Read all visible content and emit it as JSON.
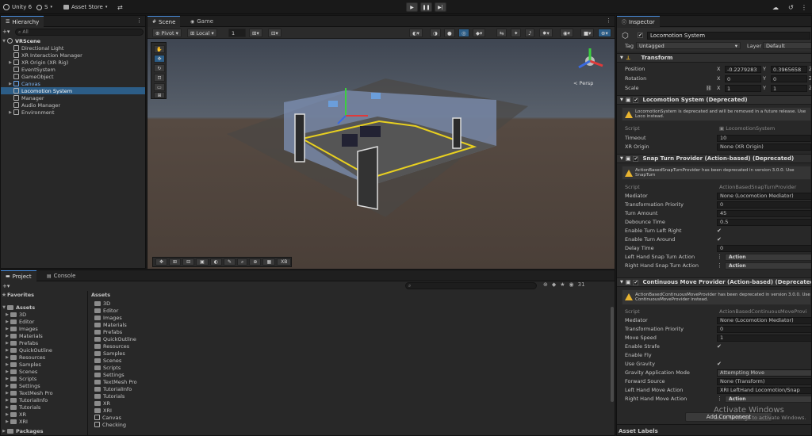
{
  "topbar": {
    "unity_label": "Unity 6",
    "account_label": "S",
    "asset_store_label": "Asset Store"
  },
  "hierarchy": {
    "tab": "Hierarchy",
    "search_placeholder": "All",
    "scene": "VRScene",
    "items": [
      {
        "label": "Directional Light",
        "indent": 1,
        "expand": false
      },
      {
        "label": "XR Interaction Manager",
        "indent": 1,
        "expand": false
      },
      {
        "label": "XR Origin (XR Rig)",
        "indent": 1,
        "expand": true
      },
      {
        "label": "EventSystem",
        "indent": 1,
        "expand": false
      },
      {
        "label": "GameObject",
        "indent": 1,
        "expand": false
      },
      {
        "label": "Canvas",
        "indent": 1,
        "expand": true,
        "blue": true
      },
      {
        "label": "Locomotion System",
        "indent": 1,
        "expand": false,
        "selected": true
      },
      {
        "label": "Manager",
        "indent": 1,
        "expand": false
      },
      {
        "label": "Audio Manager",
        "indent": 1,
        "expand": false
      },
      {
        "label": "Environment",
        "indent": 1,
        "expand": true
      }
    ]
  },
  "scene": {
    "tabs": [
      "Scene",
      "Game"
    ],
    "pivot": "Pivot",
    "local": "Local",
    "grid_value": "1",
    "persp": "< Persp",
    "bottom_tool_label": "XB"
  },
  "project": {
    "tabs": [
      "Project",
      "Console"
    ],
    "favorites": "Favorites",
    "assets_root": "Assets",
    "tree": [
      "3D",
      "Editor",
      "Images",
      "Materials",
      "Prefabs",
      "QuickOutline",
      "Resources",
      "Samples",
      "Scenes",
      "Scripts",
      "Settings",
      "TextMesh Pro",
      "TutorialInfo",
      "Tutorials",
      "XR",
      "XRI"
    ],
    "packages": "Packages",
    "breadcrumb": "Assets",
    "count": "31",
    "list": [
      "3D",
      "Editor",
      "Images",
      "Materials",
      "Prefabs",
      "QuickOutline",
      "Resources",
      "Samples",
      "Scenes",
      "Scripts",
      "Settings",
      "TextMesh Pro",
      "TutorialInfo",
      "Tutorials",
      "XR",
      "XRI",
      "Canvas",
      "Checking"
    ]
  },
  "inspector": {
    "tab": "Inspector",
    "object_name": "Locomotion System",
    "tag_label": "Tag",
    "tag_value": "Untagged",
    "layer_label": "Layer",
    "layer_value": "Default",
    "transform": {
      "title": "Transform",
      "position_label": "Position",
      "rotation_label": "Rotation",
      "scale_label": "Scale",
      "pos_x": "-0.2279283",
      "pos_y": "0.3965658",
      "rot_x": "0",
      "rot_y": "0",
      "scale_x": "1",
      "scale_y": "1"
    },
    "loco": {
      "title": "Locomotion System (Deprecated)",
      "warning": "LocomotionSystem is deprecated and will be removed in a future release. Use Loco instead.",
      "script_label": "Script",
      "script_value": "LocomotionSystem",
      "timeout_label": "Timeout",
      "timeout_value": "10",
      "xr_origin_label": "XR Origin",
      "xr_origin_value": "None (XR Origin)"
    },
    "snap": {
      "title": "Snap Turn Provider (Action-based) (Deprecated)",
      "warning": "ActionBasedSnapTurnProvider has been deprecated in version 3.0.0. Use SnapTurn",
      "rows": [
        {
          "label": "Script",
          "value": "ActionBasedSnapTurnProvider",
          "dim": true
        },
        {
          "label": "Mediator",
          "value": "None (Locomotion Mediator)"
        },
        {
          "label": "Transformation Priority",
          "value": "0"
        },
        {
          "label": "Turn Amount",
          "value": "45"
        },
        {
          "label": "Debounce Time",
          "value": "0.5"
        },
        {
          "label": "Enable Turn Left Right",
          "value": "✔",
          "check": true
        },
        {
          "label": "Enable Turn Around",
          "value": "✔",
          "check": true
        },
        {
          "label": "Delay Time",
          "value": "0"
        },
        {
          "label": "Left Hand Snap Turn Action",
          "value": "Action",
          "action": true
        },
        {
          "label": "Right Hand Snap Turn Action",
          "value": "Action",
          "action": true
        }
      ]
    },
    "move": {
      "title": "Continuous Move Provider (Action-based) (Deprecated)",
      "warning": "ActionBasedContinuousMoveProvider has been deprecated in version 3.0.0. Use ContinuousMoveProvider instead.",
      "rows": [
        {
          "label": "Script",
          "value": "ActionBasedContinuousMoveProvi",
          "dim": true
        },
        {
          "label": "Mediator",
          "value": "None (Locomotion Mediator)"
        },
        {
          "label": "Transformation Priority",
          "value": "0"
        },
        {
          "label": "Move Speed",
          "value": "1"
        },
        {
          "label": "Enable Strafe",
          "value": "✔",
          "check": true
        },
        {
          "label": "Enable Fly",
          "value": "",
          "check": true
        },
        {
          "label": "Use Gravity",
          "value": "✔",
          "check": true
        },
        {
          "label": "Gravity Application Mode",
          "value": "Attempting Move",
          "dropdown": true
        },
        {
          "label": "Forward Source",
          "value": "None (Transform)"
        },
        {
          "label": "Left Hand Move Action",
          "value": "XRI LeftHand Locomotion/Snap"
        },
        {
          "label": "Right Hand Move Action",
          "value": "Action",
          "action": true
        }
      ]
    },
    "add_component": "Add Component",
    "asset_labels": "Asset Labels"
  },
  "watermark": {
    "line1": "Activate Windows",
    "line2": "Go to Settings to activate Windows."
  },
  "colors": {
    "selection": "#2c5d87",
    "accent": "#4a90e2",
    "warning": "#e8b430"
  }
}
